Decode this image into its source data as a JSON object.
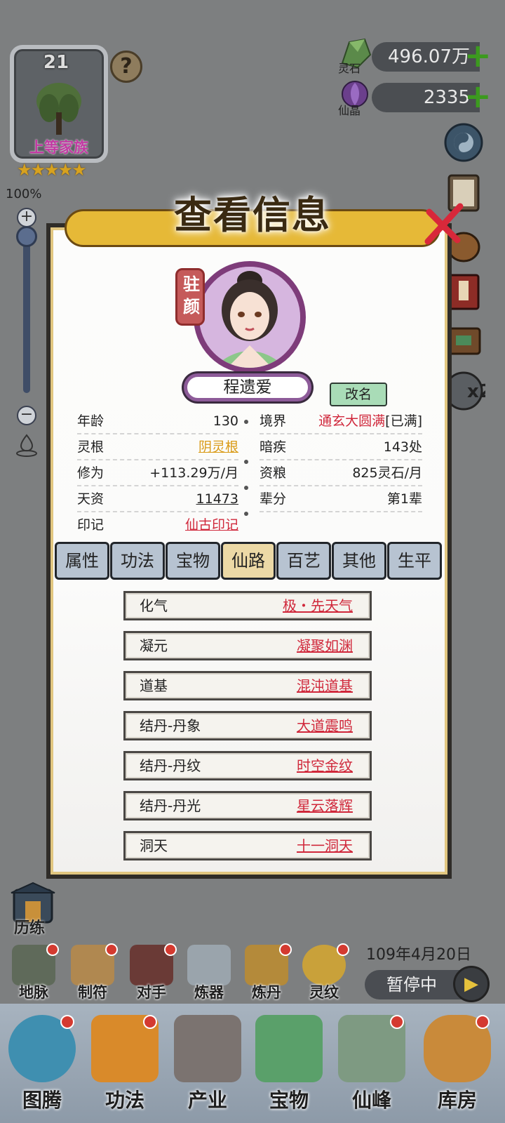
{
  "family": {
    "level": "21",
    "rank": "上等家族",
    "stars": "★★★★★"
  },
  "zoom": {
    "label": "100%",
    "value": 1.0
  },
  "currencies": [
    {
      "name": "灵石",
      "value": "496.07万"
    },
    {
      "name": "仙晶",
      "value": "2335"
    }
  ],
  "dialog": {
    "title": "查看信息",
    "seal": "驻颜",
    "character_name": "程遗爱",
    "rename_label": "改名",
    "info_left": [
      {
        "label": "年龄",
        "value": "130"
      },
      {
        "label": "灵根",
        "value": "阴灵根"
      },
      {
        "label": "修为",
        "value": "+113.29万/月"
      },
      {
        "label": "天资",
        "value": "11473"
      },
      {
        "label": "印记",
        "value": "仙古印记"
      }
    ],
    "info_right": [
      {
        "label": "境界",
        "value": "通玄大圆满",
        "suffix": "[已满]"
      },
      {
        "label": "暗疾",
        "value": "143处"
      },
      {
        "label": "资粮",
        "value": "825灵石/月"
      },
      {
        "label": "辈分",
        "value": "第1辈"
      }
    ],
    "tabs": [
      "属性",
      "功法",
      "宝物",
      "仙路",
      "百艺",
      "其他",
      "生平"
    ],
    "active_tab": "仙路",
    "path": [
      {
        "name": "化气",
        "value": "极・先天气"
      },
      {
        "name": "凝元",
        "value": "凝聚如渊"
      },
      {
        "name": "道基",
        "value": "混沌道基"
      },
      {
        "name": "结丹-丹象",
        "value": "大道震鸣"
      },
      {
        "name": "结丹-丹纹",
        "value": "时空金纹"
      },
      {
        "name": "结丹-丹光",
        "value": "星云落辉"
      },
      {
        "name": "洞天",
        "value": "十一洞天"
      }
    ]
  },
  "training_label": "历练",
  "date": "109年4月20日",
  "pause_label": "暂停中",
  "skills": [
    "地脉",
    "制符",
    "对手",
    "炼器",
    "炼丹",
    "灵纹"
  ],
  "nav": [
    "图腾",
    "功法",
    "产业",
    "宝物",
    "仙峰",
    "库房"
  ],
  "colors": {
    "accent_red": "#d0283b",
    "link_gold": "#d99a16",
    "ribbon": "#e6b937",
    "active_tab": "#ecd9a6",
    "tab": "#b7c3d1"
  }
}
